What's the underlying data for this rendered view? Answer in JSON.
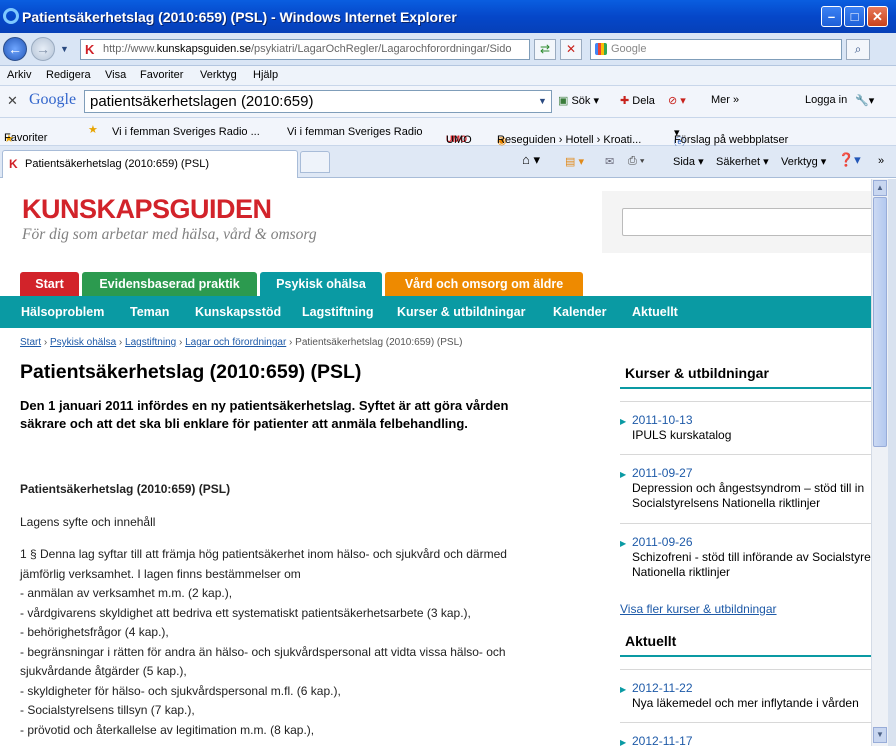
{
  "window": {
    "title": "Patientsäkerhetslag (2010:659) (PSL) - Windows Internet Explorer"
  },
  "address": {
    "url_prefix": "http://www.",
    "url_domain": "kunskapsguiden.se",
    "url_rest": "/psykiatri/LagarOchRegler/Lagarochforordningar/Sido",
    "search_placeholder": "Google"
  },
  "menu": {
    "items": [
      "Arkiv",
      "Redigera",
      "Visa",
      "Favoriter",
      "Verktyg",
      "Hjälp"
    ]
  },
  "google_toolbar": {
    "logo": "Google",
    "query": "patientsäkerhetslagen (2010:659)",
    "search": "Sök",
    "share": "Dela",
    "more": "Mer",
    "login": "Logga in"
  },
  "favorites": {
    "label": "Favoriter",
    "items": [
      "Vi i femman  Sveriges Radio ...",
      "Vi i femman  Sveriges Radio",
      "UMO",
      "Reseguiden › Hotell › Kroati...",
      "Förslag på webbplatser"
    ]
  },
  "tabs": {
    "active": "Patientsäkerhetslag (2010:659) (PSL)"
  },
  "commands": {
    "page": "Sida",
    "safety": "Säkerhet",
    "tools": "Verktyg"
  },
  "site": {
    "logo": "KUNSKAPSGUIDEN",
    "tagline": "För dig som arbetar med hälsa, vård & omsorg",
    "top_tabs": [
      {
        "label": "Start",
        "color": "#d2232a"
      },
      {
        "label": "Evidensbaserad praktik",
        "color": "#2c9a4f"
      },
      {
        "label": "Psykisk ohälsa",
        "color": "#0a9aa3"
      },
      {
        "label": "Vård och omsorg om äldre",
        "color": "#ee8a00"
      }
    ],
    "subnav": [
      "Hälsoproblem",
      "Teman",
      "Kunskapsstöd",
      "Lagstiftning",
      "Kurser & utbildningar",
      "Kalender",
      "Aktuellt"
    ]
  },
  "breadcrumb": {
    "items": [
      "Start",
      "Psykisk ohälsa",
      "Lagstiftning",
      "Lagar och förordningar"
    ],
    "current": "Patientsäkerhetslag (2010:659) (PSL)"
  },
  "article": {
    "title": "Patientsäkerhetslag (2010:659) (PSL)",
    "lead": "Den 1 januari 2011 infördes en ny patientsäkerhetslag. Syftet är att göra vården säkrare och att det ska bli enklare för patienter att anmäla felbehandling.",
    "sub_title": "Patientsäkerhetslag (2010:659) (PSL)",
    "section": "Lagens syfte och innehåll",
    "lines": [
      "1 § Denna lag syftar till att främja hög patientsäkerhet inom hälso- och sjukvård och därmed",
      "jämförlig verksamhet. I lagen finns bestämmelser om",
      "- anmälan av verksamhet m.m. (2 kap.),",
      "- vårdgivarens skyldighet att bedriva ett systematiskt patientsäkerhetsarbete (3 kap.),",
      "- behörighetsfrågor (4 kap.),",
      "- begränsningar i rätten för andra än hälso- och sjukvårdspersonal att vidta vissa hälso- och",
      "sjukvårdande åtgärder (5 kap.),",
      "- skyldigheter för hälso- och sjukvårdspersonal m.fl. (6 kap.),",
      "- Socialstyrelsens tillsyn (7 kap.),",
      "- prövotid och återkallelse av legitimation m.m. (8 kap.),"
    ]
  },
  "sidebar": {
    "courses_title": "Kurser & utbildningar",
    "courses": [
      {
        "date": "2011-10-13",
        "lines": [
          "IPULS kurskatalog"
        ]
      },
      {
        "date": "2011-09-27",
        "lines": [
          "Depression och ångestsyndrom – stöd till in",
          "Socialstyrelsens Nationella riktlinjer"
        ]
      },
      {
        "date": "2011-09-26",
        "lines": [
          "Schizofreni - stöd till införande av Socialstyre",
          "Nationella riktlinjer"
        ]
      }
    ],
    "courses_more": "Visa fler kurser & utbildningar",
    "news_title": "Aktuellt",
    "news": [
      {
        "date": "2012-11-22",
        "lines": [
          "Nya läkemedel och mer inflytande i vården"
        ]
      },
      {
        "date": "2012-11-17",
        "lines": [
          ""
        ]
      }
    ]
  }
}
